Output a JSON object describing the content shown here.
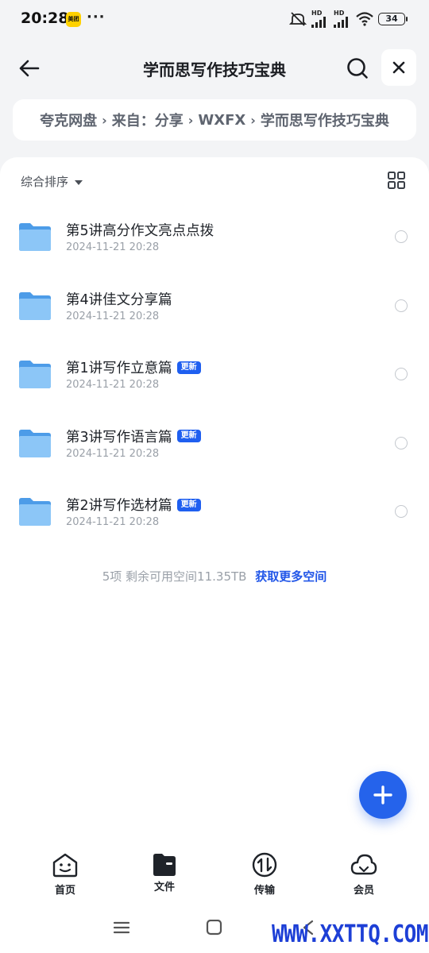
{
  "status_bar": {
    "time": "20:28",
    "app_badge": "美团",
    "dots": "···",
    "signal1_label": "HD",
    "signal2_label": "HD",
    "battery": "34"
  },
  "header": {
    "title": "学而思写作技巧宝典",
    "back_icon": "arrow-left-icon",
    "search_icon": "search-icon",
    "close_icon": "close-icon"
  },
  "breadcrumb": {
    "items": [
      "夸克网盘",
      "来自：分享",
      "WXFX",
      "学而思写作技巧宝典"
    ],
    "separator": "›"
  },
  "toolbar": {
    "sort_label": "综合排序",
    "view_icon": "grid-view-icon"
  },
  "files": [
    {
      "name": "第5讲高分作文亮点点拨",
      "date": "2024-11-21 20:28",
      "badge": ""
    },
    {
      "name": "第4讲佳文分享篇",
      "date": "2024-11-21 20:28",
      "badge": ""
    },
    {
      "name": "第1讲写作立意篇",
      "date": "2024-11-21 20:28",
      "badge": "更新"
    },
    {
      "name": "第3讲写作语言篇",
      "date": "2024-11-21 20:28",
      "badge": "更新"
    },
    {
      "name": "第2讲写作选材篇",
      "date": "2024-11-21 20:28",
      "badge": "更新"
    }
  ],
  "summary": {
    "text": "5项 剩余可用空间11.35TB",
    "link": "获取更多空间"
  },
  "bottom_nav": [
    {
      "label": "首页",
      "icon": "home-face-icon"
    },
    {
      "label": "文件",
      "icon": "file-folder-icon"
    },
    {
      "label": "传输",
      "icon": "transfer-icon"
    },
    {
      "label": "会员",
      "icon": "cloud-member-icon"
    }
  ],
  "watermark": "WWW.XXTTQ.COM",
  "colors": {
    "accent": "#2563eb",
    "badge": "#1f5ff0",
    "folder": "#5aa9f2",
    "background": "#f3f4f6"
  }
}
